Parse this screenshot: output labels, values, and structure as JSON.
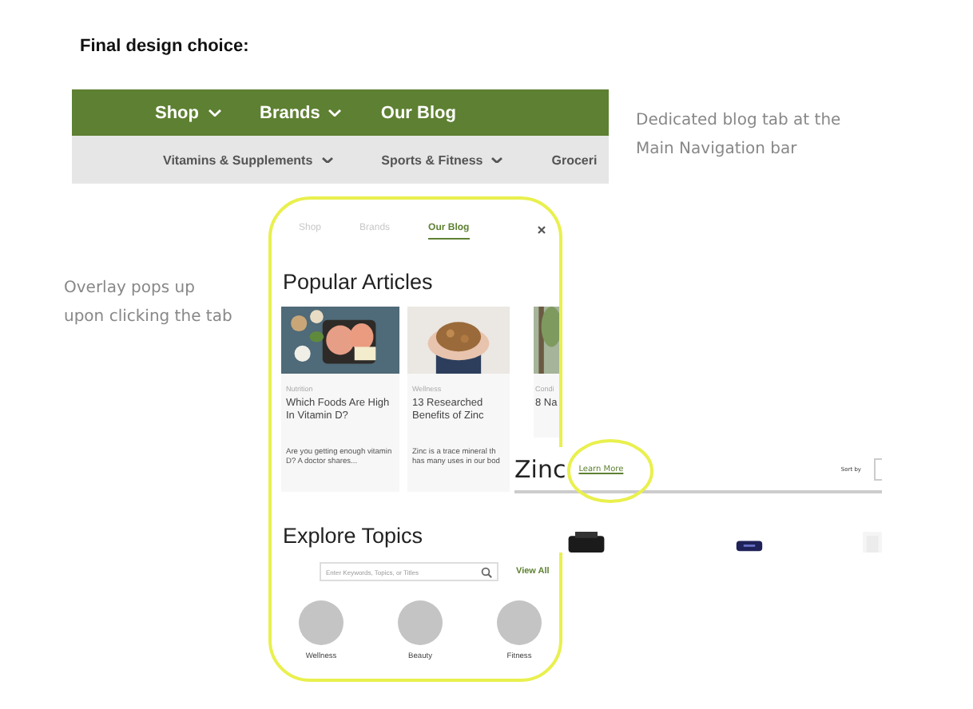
{
  "heading": "Final design choice:",
  "main_nav": {
    "tabs": [
      {
        "label": "Shop",
        "has_menu": true
      },
      {
        "label": "Brands",
        "has_menu": true
      },
      {
        "label": "Our Blog",
        "has_menu": false
      }
    ],
    "subnav": [
      {
        "label": "Vitamins & Supplements",
        "has_menu": true
      },
      {
        "label": "Sports & Fitness",
        "has_menu": true
      },
      {
        "label": "Groceri",
        "has_menu": false
      }
    ]
  },
  "annotations": [
    {
      "text": "Dedicated blog tab at the Main Navigation bar"
    },
    {
      "text": "Overlay pops up upon clicking the tab"
    }
  ],
  "overlay": {
    "tabs": [
      {
        "label": "Shop",
        "selected": false
      },
      {
        "label": "Brands",
        "selected": false
      },
      {
        "label": "Our Blog",
        "selected": true
      }
    ],
    "popular_title": "Popular Articles",
    "articles": [
      {
        "category": "Nutrition",
        "title": "Which Foods Are High In Vitamin D?",
        "excerpt": "Are you getting enough vitamin D? A doctor shares..."
      },
      {
        "category": "Wellness",
        "title": "13 Researched Benefits of Zinc",
        "excerpt": "Zinc is a trace mineral th has many uses in our bod"
      },
      {
        "category": "Condi",
        "title": "8 Na"
      }
    ],
    "explore_title": "Explore Topics",
    "search": {
      "placeholder": "Enter Keywords, Topics, or Titles"
    },
    "view_all": "View All",
    "topics": [
      {
        "label": "Wellness"
      },
      {
        "label": "Beauty"
      },
      {
        "label": "Fitness"
      }
    ]
  },
  "zinc_panel": {
    "title": "Zinc",
    "link": "Learn More",
    "sort_label": "Sort by"
  }
}
